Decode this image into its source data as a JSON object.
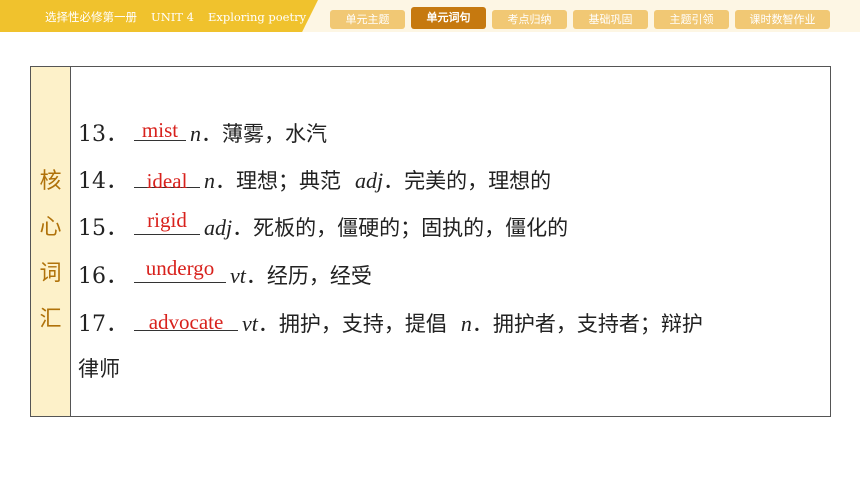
{
  "header": {
    "book": "选择性必修第一册",
    "unit": "UNIT 4",
    "topic": "Exploring poetry"
  },
  "nav": [
    {
      "label": "单元主题",
      "active": false
    },
    {
      "label": "单元词句",
      "active": true
    },
    {
      "label": "考点归纳",
      "active": false
    },
    {
      "label": "基础巩固",
      "active": false
    },
    {
      "label": "主题引领",
      "active": false
    },
    {
      "label": "课时数智作业",
      "active": false
    }
  ],
  "side_label": [
    "核",
    "心",
    "词",
    "汇"
  ],
  "items": [
    {
      "num": "13．",
      "answer": "mist",
      "pos": "n",
      "def": "．薄雾，水汽"
    },
    {
      "num": "14．",
      "answer": "ideal",
      "pos": "n",
      "def": "．理想；典范",
      "pos2": "adj",
      "def2": "．完美的，理想的"
    },
    {
      "num": "15．",
      "answer": "rigid",
      "pos": "adj",
      "def": "．死板的，僵硬的；固执的，僵化的"
    },
    {
      "num": "16．",
      "answer": "undergo",
      "pos": "vt",
      "def": "．经历，经受"
    },
    {
      "num": "17．",
      "answer": "advocate",
      "pos": "vt",
      "def": "．拥护，支持，提倡",
      "pos2": "n",
      "def2": "．拥护者，支持者；辩护"
    },
    {
      "continuation": "律师"
    }
  ],
  "colors": {
    "accent": "#f0c22d",
    "nav_active": "#c6790f",
    "nav_inactive": "#f1c874",
    "answer_red": "#d8211c",
    "side_text": "#b0720a"
  }
}
